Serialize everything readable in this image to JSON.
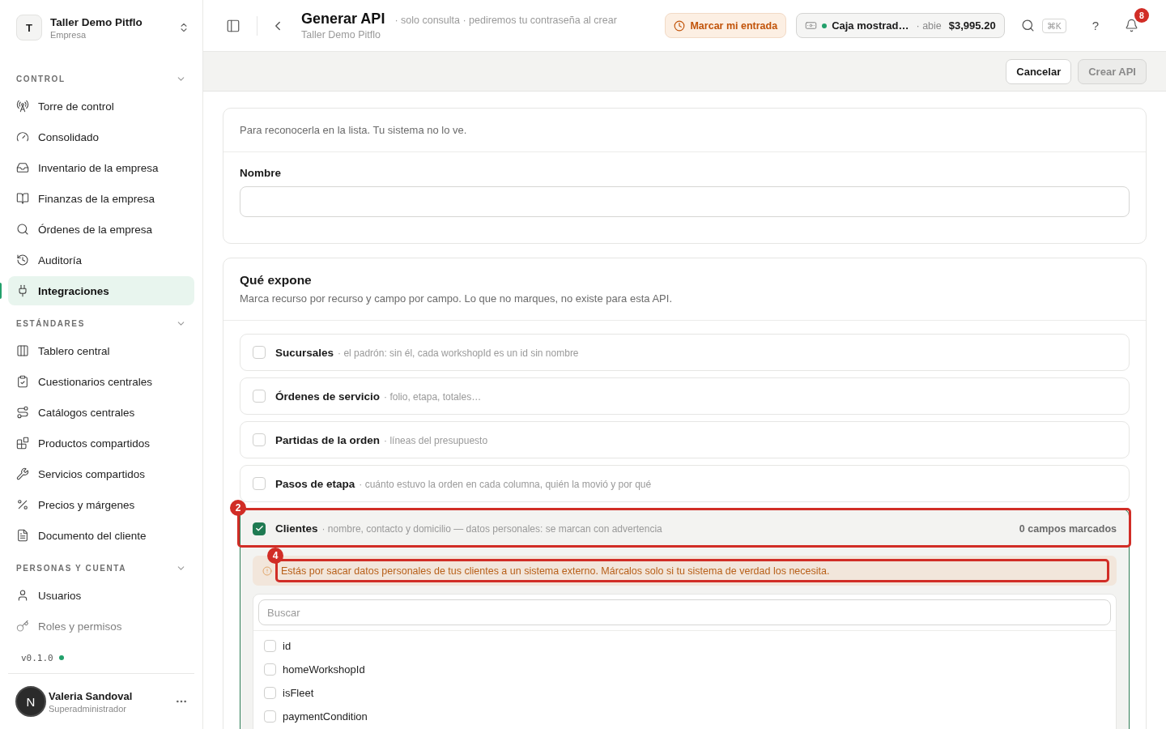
{
  "sidebar": {
    "workspace": {
      "initial": "T",
      "name": "Taller Demo Pitflo",
      "type": "Empresa"
    },
    "sections": [
      {
        "title": "CONTROL",
        "expanded": true,
        "items": [
          {
            "label": "Torre de control",
            "selected": false
          },
          {
            "label": "Consolidado",
            "selected": false
          },
          {
            "label": "Inventario de la empresa",
            "selected": false
          },
          {
            "label": "Finanzas de la empresa",
            "selected": false
          },
          {
            "label": "Órdenes de la empresa",
            "selected": false
          },
          {
            "label": "Auditoría",
            "selected": false
          },
          {
            "label": "Integraciones",
            "selected": true
          }
        ]
      },
      {
        "title": "ESTÁNDARES",
        "expanded": true,
        "items": [
          {
            "label": "Tablero central",
            "selected": false
          },
          {
            "label": "Cuestionarios centrales",
            "selected": false
          },
          {
            "label": "Catálogos centrales",
            "selected": false
          },
          {
            "label": "Productos compartidos",
            "selected": false
          },
          {
            "label": "Servicios compartidos",
            "selected": false
          },
          {
            "label": "Precios y márgenes",
            "selected": false
          },
          {
            "label": "Documento del cliente",
            "selected": false
          }
        ]
      },
      {
        "title": "PERSONAS Y CUENTA",
        "expanded": true,
        "items": [
          {
            "label": "Usuarios",
            "selected": false
          },
          {
            "label": "Roles y permisos",
            "selected": false
          }
        ]
      }
    ],
    "version": "v0.1.0",
    "user": {
      "initial": "N",
      "name": "Valeria Sandoval",
      "role": "Superadministrador"
    }
  },
  "header": {
    "title": "Generar API",
    "subtitle": "· solo consulta · pediremos tu contraseña al crear",
    "context": "Taller Demo Pitflo",
    "clock_in": {
      "label": "Marcar mi entrada"
    },
    "register": {
      "name": "Caja mostrad…",
      "open": true,
      "status": "· abie",
      "balance": "$3,995.20"
    },
    "search_shortcut": "⌘K",
    "help": "?",
    "notifications": "8"
  },
  "actions": [
    {
      "label": "Cancelar",
      "kind": "secondary",
      "disabled": false
    },
    {
      "label": "Crear API",
      "kind": "primary",
      "disabled": true
    }
  ],
  "name_card": {
    "hint": "Para reconocerla en la lista. Tu sistema no lo ve.",
    "label": "Nombre"
  },
  "exposure": {
    "title": "Qué expone",
    "description": "Marca recurso por recurso y campo por campo. Lo que no marques, no existe para esta API.",
    "resources": [
      {
        "name": "Sucursales",
        "description": "· el padrón: sin él, cada workshopId es un id sin nombre",
        "checked": false,
        "expanded": false
      },
      {
        "name": "Órdenes de servicio",
        "description": "· folio, etapa, totales…",
        "checked": false,
        "expanded": false
      },
      {
        "name": "Partidas de la orden",
        "description": "· líneas del presupuesto",
        "checked": false,
        "expanded": false
      },
      {
        "name": "Pasos de etapa",
        "description": "· cuánto estuvo la orden en cada columna, quién la movió y por qué",
        "checked": false,
        "expanded": false
      },
      {
        "name": "Clientes",
        "description": "· nombre, contacto y domicilio — datos personales: se marcan con advertencia",
        "checked": true,
        "expanded": true,
        "count": "0 campos marcados",
        "annotation": "2",
        "warning": {
          "text": "Estás por sacar datos personales de tus clientes a un sistema externo. Márcalos solo si tu sistema de verdad los necesita.",
          "annotation": "4"
        },
        "search": {
          "placeholder": "Buscar"
        },
        "fields": [
          {
            "name": "id",
            "checked": false
          },
          {
            "name": "homeWorkshopId",
            "checked": false
          },
          {
            "name": "isFleet",
            "checked": false
          },
          {
            "name": "paymentCondition",
            "checked": false
          }
        ]
      }
    ]
  }
}
